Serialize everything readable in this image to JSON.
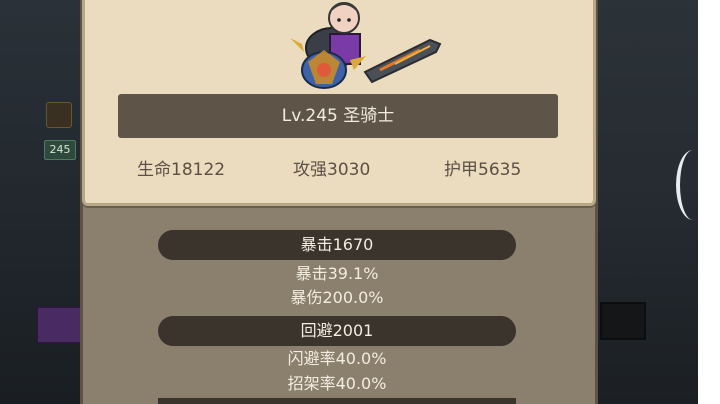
{
  "hero": {
    "level_class": "Lv.245 圣骑士",
    "stats": {
      "hp": "生命18122",
      "attack": "攻强3030",
      "armor": "护甲5635"
    }
  },
  "sections": {
    "crit": {
      "header": "暴击1670",
      "lines": [
        "暴击39.1%",
        "暴伤200.0%"
      ]
    },
    "dodge": {
      "header": "回避2001",
      "lines": [
        "闪避率40.0%",
        "招架率40.0%"
      ]
    }
  },
  "background": {
    "level_chip": "245"
  },
  "colors": {
    "parchment": "#ecdcbf",
    "panel": "#8b7f6e",
    "pill": "#3a342d",
    "title_bar": "#5e5548"
  }
}
